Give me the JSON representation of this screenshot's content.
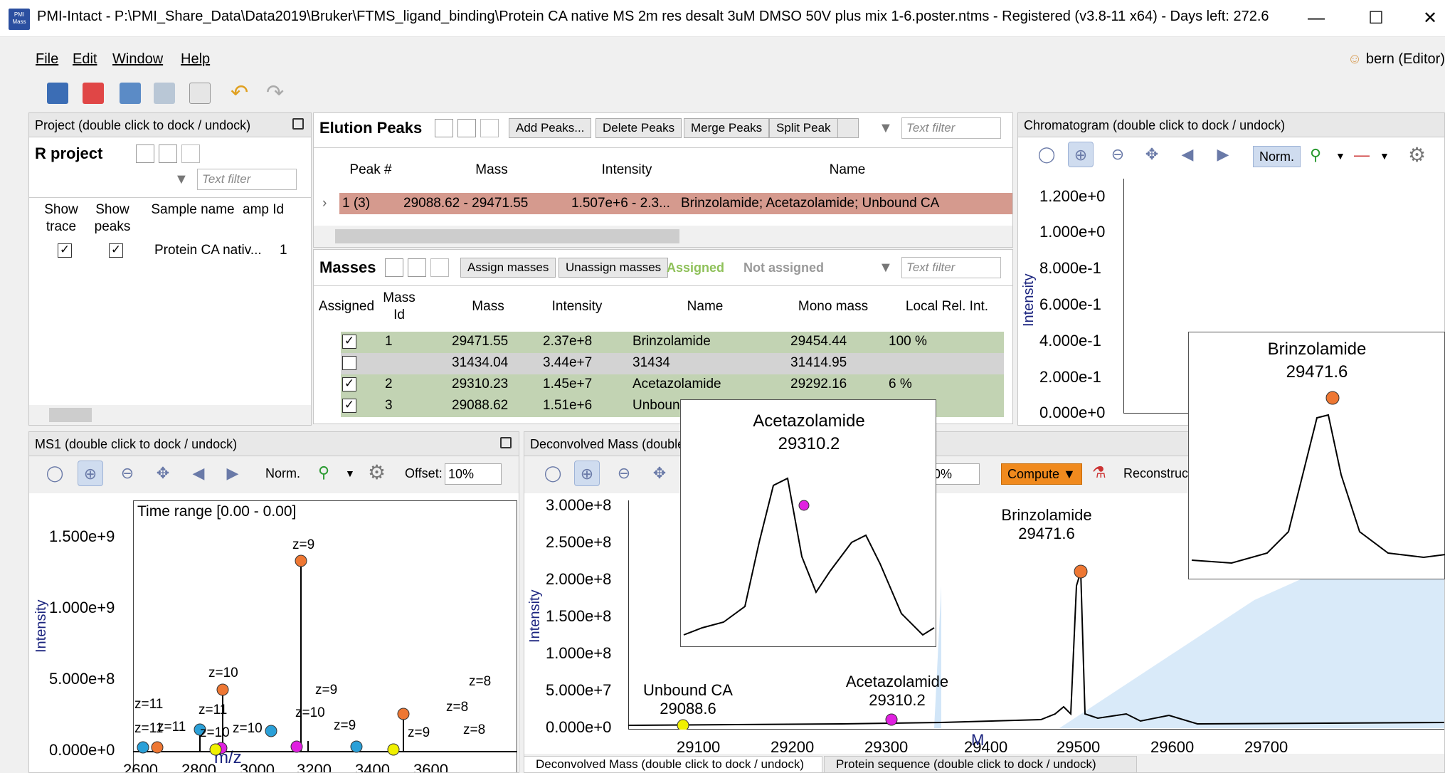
{
  "window": {
    "app_icon_text": "PMI Mass",
    "title": "PMI-Intact - P:\\PMI_Share_Data\\Data2019\\Bruker\\FTMS_ligand_binding\\Protein CA native MS 2m res desalt 3uM DMSO 50V plus mix 1-6.poster.ntms - Registered (v3.8-11 x64) - Days left: 272.6",
    "minimize": "—",
    "maximize": "☐",
    "close": "✕"
  },
  "menu": {
    "file": "File",
    "edit": "Edit",
    "window": "Window",
    "help": "Help",
    "user": "bern (Editor)"
  },
  "project": {
    "header": "Project (double click to dock / undock)",
    "title": "R project",
    "filter_placeholder": "Text filter",
    "columns": [
      "Show trace",
      "Show peaks",
      "Sample name",
      "amp Id"
    ],
    "row": {
      "show_trace": true,
      "show_peaks": true,
      "sample_name": "Protein CA nativ...",
      "id": "1"
    }
  },
  "elution": {
    "title": "Elution Peaks",
    "buttons": [
      "Add Peaks...",
      "Delete Peaks",
      "Merge Peaks",
      "Split Peak"
    ],
    "filter_placeholder": "Text filter",
    "columns": [
      "Peak #",
      "Mass",
      "Intensity",
      "Name"
    ],
    "row": {
      "peak": "1 (3)",
      "mass": "29088.62 - 29471.55",
      "intensity": "1.507e+6 - 2.3...",
      "name": "Brinzolamide; Acetazolamide; Unbound CA"
    }
  },
  "masses": {
    "title": "Masses",
    "assign_btn": "Assign masses",
    "unassign_btn": "Unassign masses",
    "assigned_legend": "Assigned",
    "not_assigned_legend": "Not assigned",
    "filter_placeholder": "Text filter",
    "columns": [
      "Assigned",
      "Mass Id",
      "Mass",
      "Intensity",
      "Name",
      "Mono mass",
      "Local Rel. Int."
    ],
    "rows": [
      {
        "assigned": true,
        "id": "1",
        "mass": "29471.55",
        "intensity": "2.37e+8",
        "name": "Brinzolamide",
        "mono": "29454.44",
        "rel": "100 %"
      },
      {
        "assigned": false,
        "id": "",
        "mass": "31434.04",
        "intensity": "3.44e+7",
        "name": "31434",
        "mono": "31414.95",
        "rel": ""
      },
      {
        "assigned": true,
        "id": "2",
        "mass": "29310.23",
        "intensity": "1.45e+7",
        "name": "Acetazolamide",
        "mono": "29292.16",
        "rel": "6 %"
      },
      {
        "assigned": true,
        "id": "3",
        "mass": "29088.62",
        "intensity": "1.51e+6",
        "name": "Unbound CA",
        "mono": "",
        "rel": ""
      }
    ]
  },
  "chromatogram": {
    "header": "Chromatogram (double click to dock / undock)",
    "norm": "Norm.",
    "ylabel": "Intensity",
    "yticks": [
      "1.200e+0",
      "1.000e+0",
      "8.000e-1",
      "6.000e-1",
      "4.000e-1",
      "2.000e-1",
      "0.000e+0"
    ]
  },
  "ms1": {
    "header": "MS1 (double click to dock / undock)",
    "norm": "Norm.",
    "offset_label": "Offset:",
    "offset_value": "10%",
    "time_range": "Time range [0.00 - 0.00]",
    "ylabel": "Intensity",
    "xlabel": "m/z",
    "yticks": [
      "1.500e+9",
      "1.000e+9",
      "5.000e+8",
      "0.000e+0"
    ],
    "xticks": [
      "2600",
      "2800",
      "3000",
      "3200",
      "3400",
      "3600"
    ],
    "zlabels": [
      "z=9",
      "z=10",
      "z=9",
      "z=10",
      "z=11",
      "z=11",
      "z=10",
      "z=10",
      "z=9",
      "z=9",
      "z=8",
      "z=8",
      "z=8",
      "z=11",
      "z=11"
    ]
  },
  "deconv": {
    "header": "Deconvolved Mass (double c",
    "offset_value": "10%",
    "compute": "Compute",
    "reconstruct": "Reconstruc",
    "ylabel": "Intensity",
    "xlabel": "M",
    "yticks": [
      "3.000e+8",
      "2.500e+8",
      "2.000e+8",
      "1.500e+8",
      "1.000e+8",
      "5.000e+7",
      "0.000e+0"
    ],
    "xticks": [
      "29100",
      "29200",
      "29300",
      "29400",
      "29500",
      "29600",
      "29700"
    ],
    "annotations": [
      {
        "name": "Unbound CA",
        "mass": "29088.6"
      },
      {
        "name": "Acetazolamide",
        "mass": "29310.2"
      },
      {
        "name": "Brinzolamide",
        "mass": "29471.6"
      }
    ],
    "inset_left": {
      "name": "Acetazolamide",
      "mass": "29310.2"
    },
    "inset_right": {
      "name": "Brinzolamide",
      "mass": "29471.6"
    }
  },
  "bottom_tabs": [
    "Deconvolved Mass (double click to dock / undock)",
    "Protein sequence (double click to dock / undock)"
  ],
  "colors": {
    "row_selected": "#d59a8e",
    "row_assigned": "#c2d3b3",
    "row_unassigned": "#d3d3d3",
    "orange": "#ee7733",
    "magenta": "#e020e0",
    "cyan": "#2aa0d8",
    "yellow": "#f0f000",
    "accent": "#f08a1e"
  }
}
